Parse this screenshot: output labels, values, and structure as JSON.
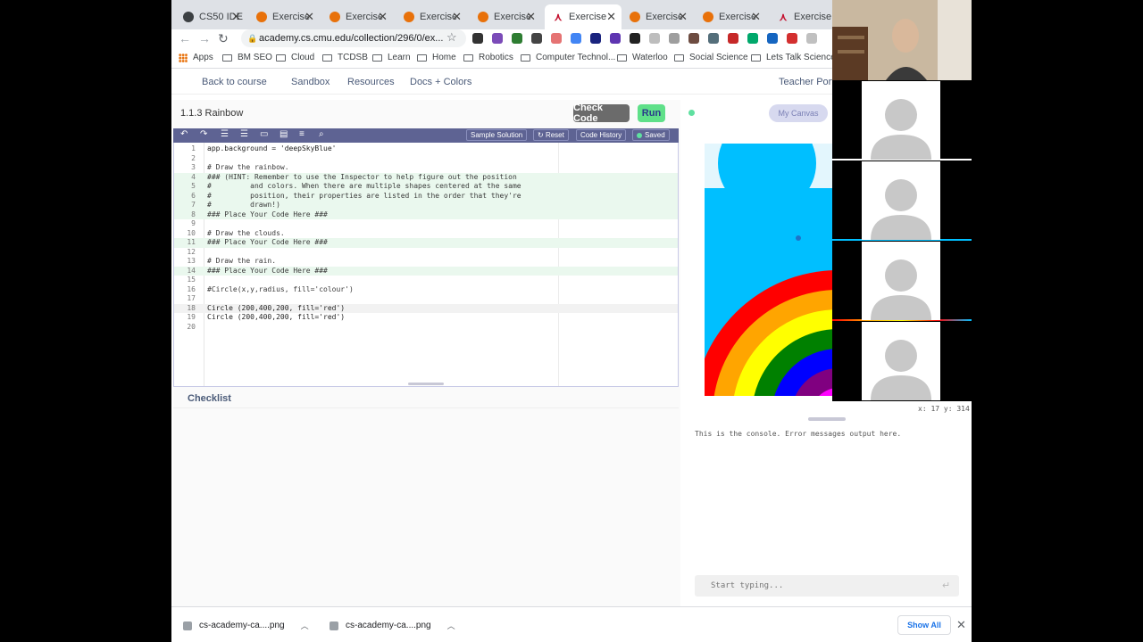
{
  "browser": {
    "tabs": [
      {
        "label": "CS50 IDE",
        "icon": "github-icon",
        "active": false
      },
      {
        "label": "Exercise",
        "icon": "exercise-icon",
        "active": false
      },
      {
        "label": "Exercise",
        "icon": "exercise-icon",
        "active": false
      },
      {
        "label": "Exercise",
        "icon": "exercise-icon",
        "active": false
      },
      {
        "label": "Exercise",
        "icon": "exercise-icon",
        "active": false
      },
      {
        "label": "Exercise",
        "icon": "cmu-icon",
        "active": true
      },
      {
        "label": "Exercise",
        "icon": "exercise-icon",
        "active": false
      },
      {
        "label": "Exercise",
        "icon": "exercise-icon",
        "active": false
      },
      {
        "label": "Exercise",
        "icon": "cmu-icon",
        "active": false
      }
    ],
    "url": "academy.cs.cmu.edu/collection/296/0/ex...",
    "bookmarks": [
      "Apps",
      "BM SEO",
      "Cloud",
      "TCDSB",
      "Learn",
      "Home",
      "Robotics",
      "Computer Technol...",
      "Waterloo",
      "Social Science",
      "Lets Talk Science"
    ]
  },
  "app_nav": {
    "links": [
      "Back to course",
      "Sandbox",
      "Resources",
      "Docs + Colors"
    ],
    "teacher_portal": "Teacher Port"
  },
  "editor": {
    "title": "1.1.3 Rainbow",
    "check_code": "Check Code",
    "run": "Run",
    "toolbar": {
      "sample_solution": "Sample Solution",
      "reset": "Reset",
      "code_history": "Code History",
      "saved": "Saved"
    },
    "code_lines": [
      "app.background = 'deepSkyBlue'",
      "",
      "# Draw the rainbow.",
      "### (HINT: Remember to use the Inspector to help figure out the position",
      "#         and colors. When there are multiple shapes centered at the same",
      "#         position, their properties are listed in the order that they're",
      "#         drawn!)",
      "### Place Your Code Here ###",
      "",
      "# Draw the clouds.",
      "### Place Your Code Here ###",
      "",
      "# Draw the rain.",
      "### Place Your Code Here ###",
      "",
      "#Circle(x,y,radius, fill='colour')",
      "",
      "Circle (200,400,200, fill='red')",
      "Circle (200,400,200, fill='red')",
      ""
    ],
    "line_numbers": [
      "1",
      "2",
      "3",
      "4",
      "5",
      "6",
      "7",
      "8",
      "9",
      "10",
      "11",
      "12",
      "13",
      "14",
      "15",
      "16",
      "17",
      "18",
      "19",
      "20"
    ],
    "checklist": "Checklist"
  },
  "canvas_panel": {
    "tab": "My Canvas",
    "coords": "x: 17 y: 314",
    "console_message": "This is the console. Error messages output here.",
    "console_placeholder": "Start typing..."
  },
  "downloads": {
    "items": [
      "cs-academy-ca....png",
      "cs-academy-ca....png"
    ],
    "show_all": "Show All"
  },
  "colors": {
    "toolbar": "#5e6393",
    "run_button": "#5fe089",
    "canvas_background": "#00bfff",
    "rainbow": [
      "#ff0000",
      "#ffa500",
      "#ffff00",
      "#008000",
      "#0000ff",
      "#800080",
      "#ff00ff"
    ]
  }
}
